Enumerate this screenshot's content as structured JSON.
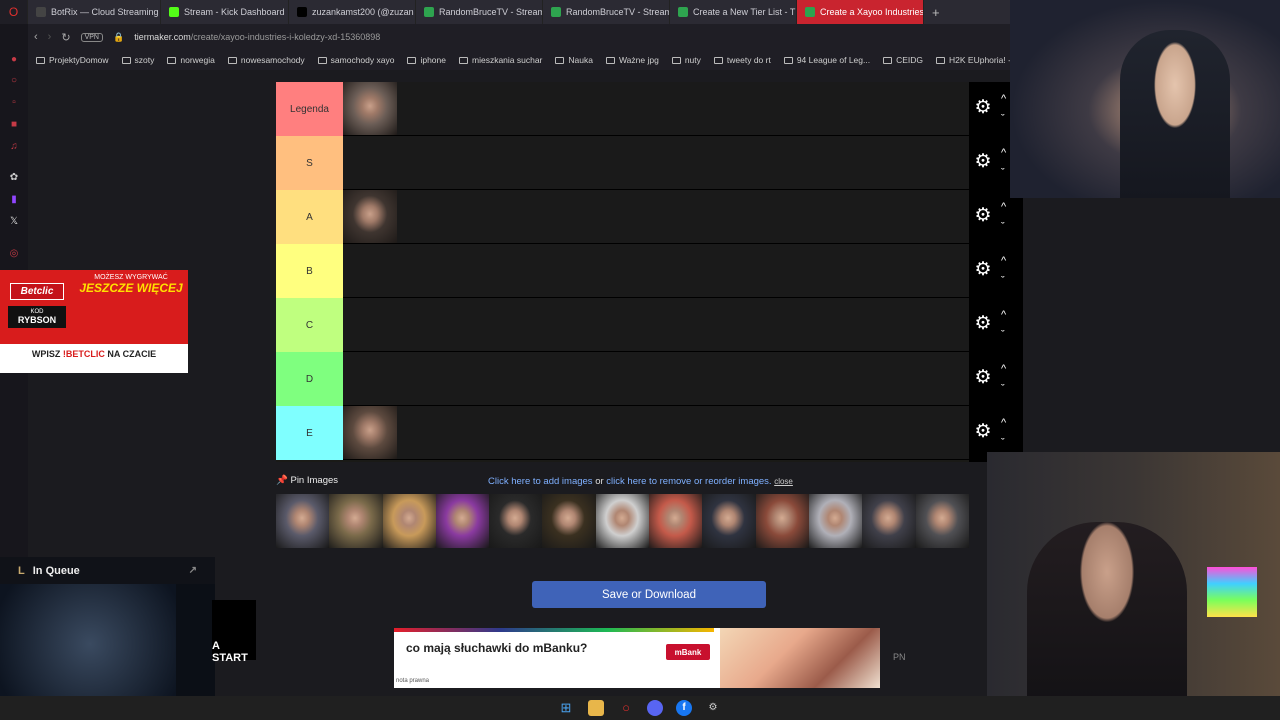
{
  "browser": {
    "tabs": [
      {
        "label": "BotRix — Cloud Streaming",
        "icon": "botrix-icon",
        "color": "#444"
      },
      {
        "label": "Stream - Kick Dashboard",
        "icon": "kick-icon",
        "color": "#53fc18"
      },
      {
        "label": "zuzankamst200 (@zuzan",
        "icon": "tiktok-icon",
        "color": "#000"
      },
      {
        "label": "RandomBruceTV - Stream",
        "icon": "tiermaker-icon",
        "color": "#2ea44f"
      },
      {
        "label": "RandomBruceTV - Stream",
        "icon": "tiermaker-icon",
        "color": "#2ea44f"
      },
      {
        "label": "Create a New Tier List - T",
        "icon": "tiermaker-icon",
        "color": "#2ea44f"
      },
      {
        "label": "Create a Xayoo Industries",
        "icon": "tiermaker-icon",
        "color": "#2ea44f"
      }
    ],
    "new_tab": "+",
    "vpn": "VPN",
    "url_host": "tiermaker.com",
    "url_path": "/create/xayoo-industries-i-koledzy-xd-15360898",
    "bookmarks": [
      "ProjektyDomow",
      "szoty",
      "norwegia",
      "nowesamochody",
      "samochody xayo",
      "iphone",
      "mieszkania suchar",
      "Nauka",
      "Ważne jpg",
      "nuty",
      "tweety do rt",
      "94 League of Leg...",
      "CEIDG",
      "H2K EUphoria! - Y..."
    ]
  },
  "tiers": [
    {
      "label": "Legenda",
      "color": "#ff7f7f",
      "has_image": true,
      "img": "#6b5d56"
    },
    {
      "label": "S",
      "color": "#ffbf7f",
      "has_image": false
    },
    {
      "label": "A",
      "color": "#ffdf7f",
      "has_image": true,
      "img": "#3f3530"
    },
    {
      "label": "B",
      "color": "#ffff7f",
      "has_image": false
    },
    {
      "label": "C",
      "color": "#bfff7f",
      "has_image": false
    },
    {
      "label": "D",
      "color": "#7fff7f",
      "has_image": false
    },
    {
      "label": "E",
      "color": "#7fffff",
      "has_image": true,
      "img": "#5d4a3f"
    }
  ],
  "pin": {
    "label": "Pin Images",
    "add_link": "Click here to add images",
    "or": " or ",
    "remove_link": "click here to remove or reorder images.",
    "close": "close"
  },
  "gallery_colors": [
    "#5a5a6a",
    "#7a6a4a",
    "#c89a5a",
    "#8a3aa0",
    "#2a2a2a",
    "#3a3020",
    "#cfcfcf",
    "#c45a4a",
    "#2f3340",
    "#8a4a3a",
    "#b0b0b8",
    "#40404a",
    "#505054"
  ],
  "save_button": "Save or Download",
  "ad": {
    "text": "co mają słuchawki do mBanku?",
    "brand": "mBank",
    "note": "nota prawna"
  },
  "pn": "PN",
  "betclic": {
    "brand": "Betclic",
    "kod_label": "KOD",
    "kod": "RYBSON",
    "head_small": "MOŻESZ WYGRYWAĆ",
    "head_big": "JESZCZE WIĘCEJ",
    "bottom_pre": "WPISZ ",
    "bottom_cmd": "!BETCLIC",
    "bottom_post": " NA CZACIE"
  },
  "queue": {
    "title": "In Queue"
  },
  "start_text": "A START"
}
